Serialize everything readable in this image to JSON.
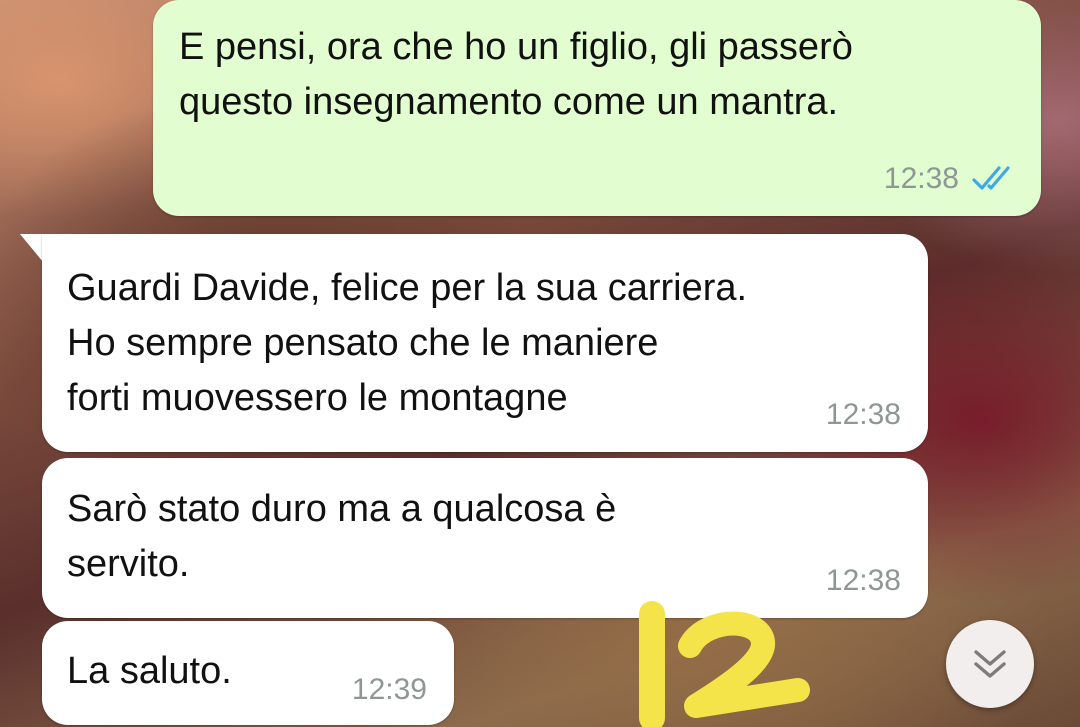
{
  "messages": [
    {
      "direction": "outgoing",
      "text": "E pensi, ora che ho un figlio, gli passerò\nquesto insegnamento come un mantra.",
      "time": "12:38",
      "status": "read"
    },
    {
      "direction": "incoming",
      "text": "Guardi Davide, felice per la sua carriera.\nHo sempre pensato che le maniere\nforti muovessero le montagne",
      "time": "12:38"
    },
    {
      "direction": "incoming",
      "text": "Sarò stato duro ma a qualcosa è\nservito.",
      "time": "12:38"
    },
    {
      "direction": "incoming",
      "text": "La saluto.",
      "time": "12:39"
    }
  ],
  "annotation": {
    "text": "12",
    "color": "#f5e34a"
  },
  "colors": {
    "outgoing_bubble": "#e2fdcf",
    "incoming_bubble": "#ffffff",
    "read_ticks": "#3fa9e8",
    "timestamp": "#8f9796"
  },
  "icons": {
    "read_receipt": "double-check-icon",
    "scroll_down": "double-chevron-down-icon"
  }
}
